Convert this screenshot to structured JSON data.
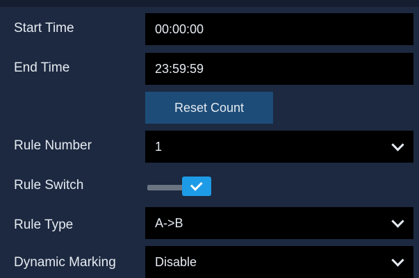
{
  "rows": {
    "start_time": {
      "label": "Start Time",
      "value": "00:00:00"
    },
    "end_time": {
      "label": "End Time",
      "value": "23:59:59"
    },
    "reset": {
      "button_label": "Reset Count"
    },
    "rule_number": {
      "label": "Rule Number",
      "value": "1",
      "icon": "chevron-down-icon"
    },
    "rule_switch": {
      "label": "Rule Switch",
      "checked": true,
      "icon": "check-icon"
    },
    "rule_type": {
      "label": "Rule Type",
      "value": "A->B",
      "icon": "chevron-down-icon"
    },
    "dynamic_marking": {
      "label": "Dynamic Marking",
      "value": "Disable",
      "icon": "chevron-down-icon"
    }
  },
  "colors": {
    "background": "#1c2940",
    "field": "#000000",
    "button": "#1d4c78",
    "toggle_on": "#1e9be6",
    "text": "#e6ebf2"
  }
}
